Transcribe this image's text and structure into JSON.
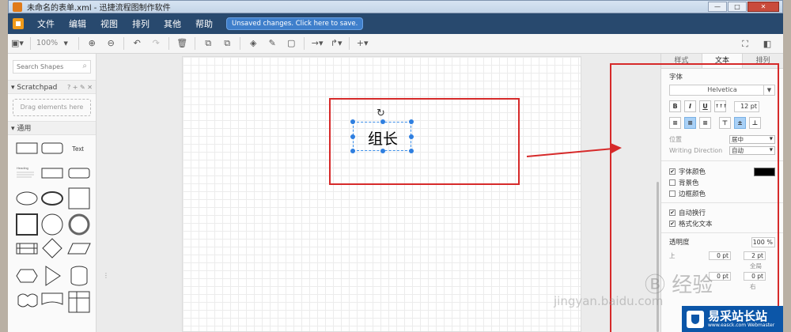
{
  "window": {
    "title": "未命名的表单.xml - 迅捷流程图制作软件",
    "controls": [
      "—",
      "□",
      "✕"
    ]
  },
  "menu": {
    "items": [
      "文件",
      "编辑",
      "视图",
      "排列",
      "其他",
      "帮助"
    ],
    "save_notice": "Unsaved changes. Click here to save."
  },
  "toolbar": {
    "zoom": "100%",
    "icons": [
      "panel-toggle-icon",
      "zoom-in-icon",
      "zoom-out-icon",
      "undo-icon",
      "redo-icon",
      "delete-icon",
      "to-front-icon",
      "to-back-icon",
      "fill-color-icon",
      "line-color-icon",
      "shadow-icon",
      "connection-icon",
      "waypoints-icon",
      "insert-icon",
      "fullscreen-icon",
      "format-panel-icon"
    ]
  },
  "sidebar": {
    "search_placeholder": "Search Shapes",
    "scratchpad_title": "Scratchpad",
    "scratchpad_tools": "? + ✎ ✕",
    "scratchpad_drop": "Drag elements here",
    "general_title": "通用",
    "text_shape_label": "Text",
    "heading_sample": "Heading"
  },
  "canvas": {
    "node_text": "组长"
  },
  "format_panel": {
    "tabs": [
      "样式",
      "文本",
      "排列"
    ],
    "active_tab": "文本",
    "font_label": "字体",
    "font_name": "Helvetica",
    "style_buttons": [
      "B",
      "I",
      "U",
      "↑↑↑"
    ],
    "font_size": "12 pt",
    "position_label": "位置",
    "position_value": "居中",
    "writing_direction_label": "Writing Direction",
    "writing_direction_value": "自动",
    "font_color_label": "字体颜色",
    "font_color": "#000000",
    "bg_color_label": "背景色",
    "border_color_label": "边框颜色",
    "word_wrap_label": "自动换行",
    "formatted_text_label": "格式化文本",
    "opacity_label": "透明度",
    "opacity_value": "100 %",
    "spacing_top_label": "上",
    "spacing_global_label": "全局",
    "spacing_right_label": "右",
    "spacing_values": [
      "0 pt",
      "2 pt",
      "0 pt",
      "0 pt"
    ]
  },
  "watermarks": {
    "site_cn": "易采站长站",
    "site_url": "www.easck.com Webmaster",
    "jingyan": "经验",
    "jingyan_url": "jingyan.baidu.com"
  },
  "colors": {
    "menubar": "#28496e",
    "accent": "#3f7fcb",
    "annotation_red": "#d62a2a",
    "selection_blue": "#2f7fe0"
  }
}
